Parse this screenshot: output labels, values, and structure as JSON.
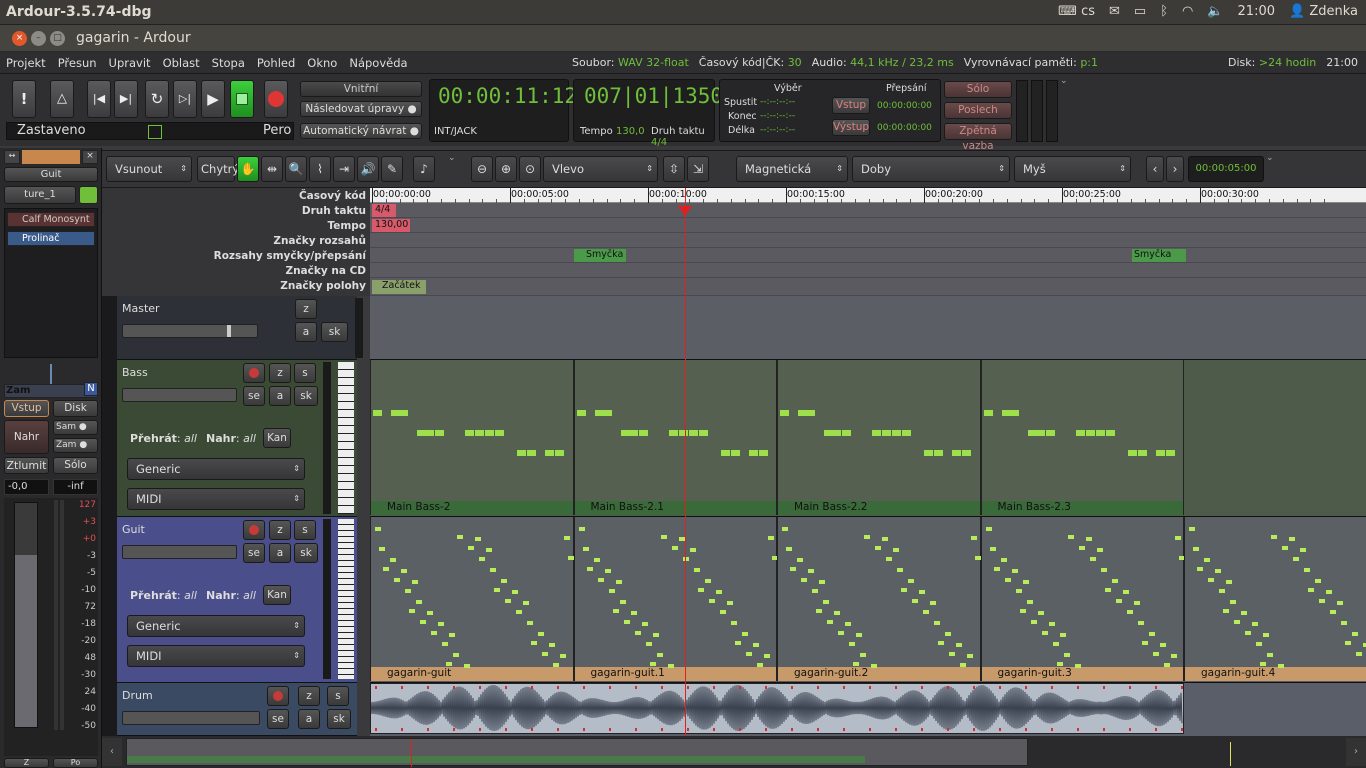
{
  "system": {
    "app_title": "Ardour-3.5.74-dbg",
    "keyboard": "cs",
    "clock": "21:00",
    "user": "Zdenka"
  },
  "window": {
    "title": "gagarin - Ardour"
  },
  "menu": [
    "Projekt",
    "Přesun",
    "Upravit",
    "Oblast",
    "Stopa",
    "Pohled",
    "Okno",
    "Nápověda"
  ],
  "status": {
    "file_label": "Soubor:",
    "file_value": "WAV 32-float",
    "tc_label": "Časový kód|ČK:",
    "tc_value": "30",
    "audio_label": "Audio:",
    "audio_value": "44,1 kHz / 23,2 ms",
    "buffer_label": "Vyrovnávací paměti:",
    "buffer_value": "p:1",
    "disk_label": "Disk:",
    "disk_value": ">24 hodin",
    "time": "21:00"
  },
  "transport": {
    "state": "Zastaveno",
    "pen": "Pero",
    "internal": "Vnitřní",
    "follow": "Následovat úpravy",
    "autoreturn": "Automatický návrat",
    "primary_clock": "00:00:11:12",
    "sync": "INT/JACK",
    "bbt_clock": "007|01|1350",
    "tempo_label": "Tempo",
    "tempo_value": "130,0",
    "meter_label": "Druh taktu",
    "meter_value": "4/4"
  },
  "punch": {
    "select_label": "Výběr",
    "punch_label": "Přepsání",
    "start": "Spustit",
    "end": "Konec",
    "length": "Délka",
    "dash": "--:--:--:--",
    "in": "Vstup",
    "out": "Výstup",
    "in_time": "00:00:00:00",
    "out_time": "00:00:00:00"
  },
  "monitor": {
    "solo": "Sólo",
    "listen": "Poslech",
    "feedback": "Zpětná vazba"
  },
  "toolbar": {
    "edit_mode": "Vsunout",
    "smart": "Chytrý",
    "zoom_focus": "Vlevo",
    "snap_mode": "Magnetická",
    "grid": "Doby",
    "edit_point": "Myš",
    "nudge_clock": "00:00:05:00"
  },
  "left": {
    "track": "Guit",
    "name_field": "ture_1",
    "plugin1": "Calf Monosynt",
    "plugin2": "Prolinač",
    "input": "Vstup",
    "disk": "Disk",
    "rec": "Nahr",
    "sam1": "Sam",
    "zam": "Zam",
    "mute": "Ztlumit",
    "solo": "Sólo",
    "gain": "-0,0",
    "peak": "-inf",
    "zam_label": "Zam",
    "n_label": "N",
    "meter_ticks": [
      "127",
      "+3",
      "+0",
      "-3",
      "-5",
      "-10",
      "72",
      "-18",
      "-20",
      "48",
      "-30",
      "24",
      "-40",
      "-50"
    ],
    "bottom1": "Z",
    "bottom2": "Po"
  },
  "rulers": {
    "labels": [
      "Časový kód",
      "Druh taktu",
      "Tempo",
      "Značky rozsahů",
      "Rozsahy smyčky/přepsání",
      "Značky na CD",
      "Značky polohy"
    ],
    "timecodes": [
      "00:00:00:00",
      "00:00:05:00",
      "00:00:10:00",
      "00:00:15:00",
      "00:00:20:00",
      "00:00:25:00",
      "00:00:30:00"
    ],
    "meter_marker": "4/4",
    "tempo_marker": "130,00",
    "loop1": "Smyčka",
    "loop2": "Smyčka",
    "start_marker": "Začátek"
  },
  "tracks": [
    {
      "name": "Master",
      "z": "z",
      "a": "a",
      "sk": "sk"
    },
    {
      "name": "Bass",
      "z": "z",
      "s": "s",
      "se": "se",
      "a": "a",
      "sk": "sk",
      "play_label": "Přehrát",
      "play_value": "all",
      "rec_label": "Nahr",
      "rec_value": "all",
      "chan": "Kan",
      "combo1": "Generic",
      "combo2": "MIDI",
      "regions": [
        "Main Bass-2",
        "Main Bass-2.1",
        "Main Bass-2.2",
        "Main Bass-2.3"
      ]
    },
    {
      "name": "Guit",
      "z": "z",
      "s": "s",
      "se": "se",
      "a": "a",
      "sk": "sk",
      "play_label": "Přehrát",
      "play_value": "all",
      "rec_label": "Nahr",
      "rec_value": "all",
      "chan": "Kan",
      "combo1": "Generic",
      "combo2": "MIDI",
      "regions": [
        "gagarin-guit",
        "gagarin-guit.1",
        "gagarin-guit.2",
        "gagarin-guit.3",
        "gagarin-guit.4"
      ]
    },
    {
      "name": "Drum",
      "z": "z",
      "s": "s",
      "se": "se",
      "a": "a",
      "sk": "sk"
    }
  ],
  "colors": {
    "accent_green": "#6fbf3a",
    "playhead": "#e02020",
    "bass_header": "#3b4a34",
    "guit_header": "#4a4e8a",
    "drum_header": "#3a4a62"
  }
}
